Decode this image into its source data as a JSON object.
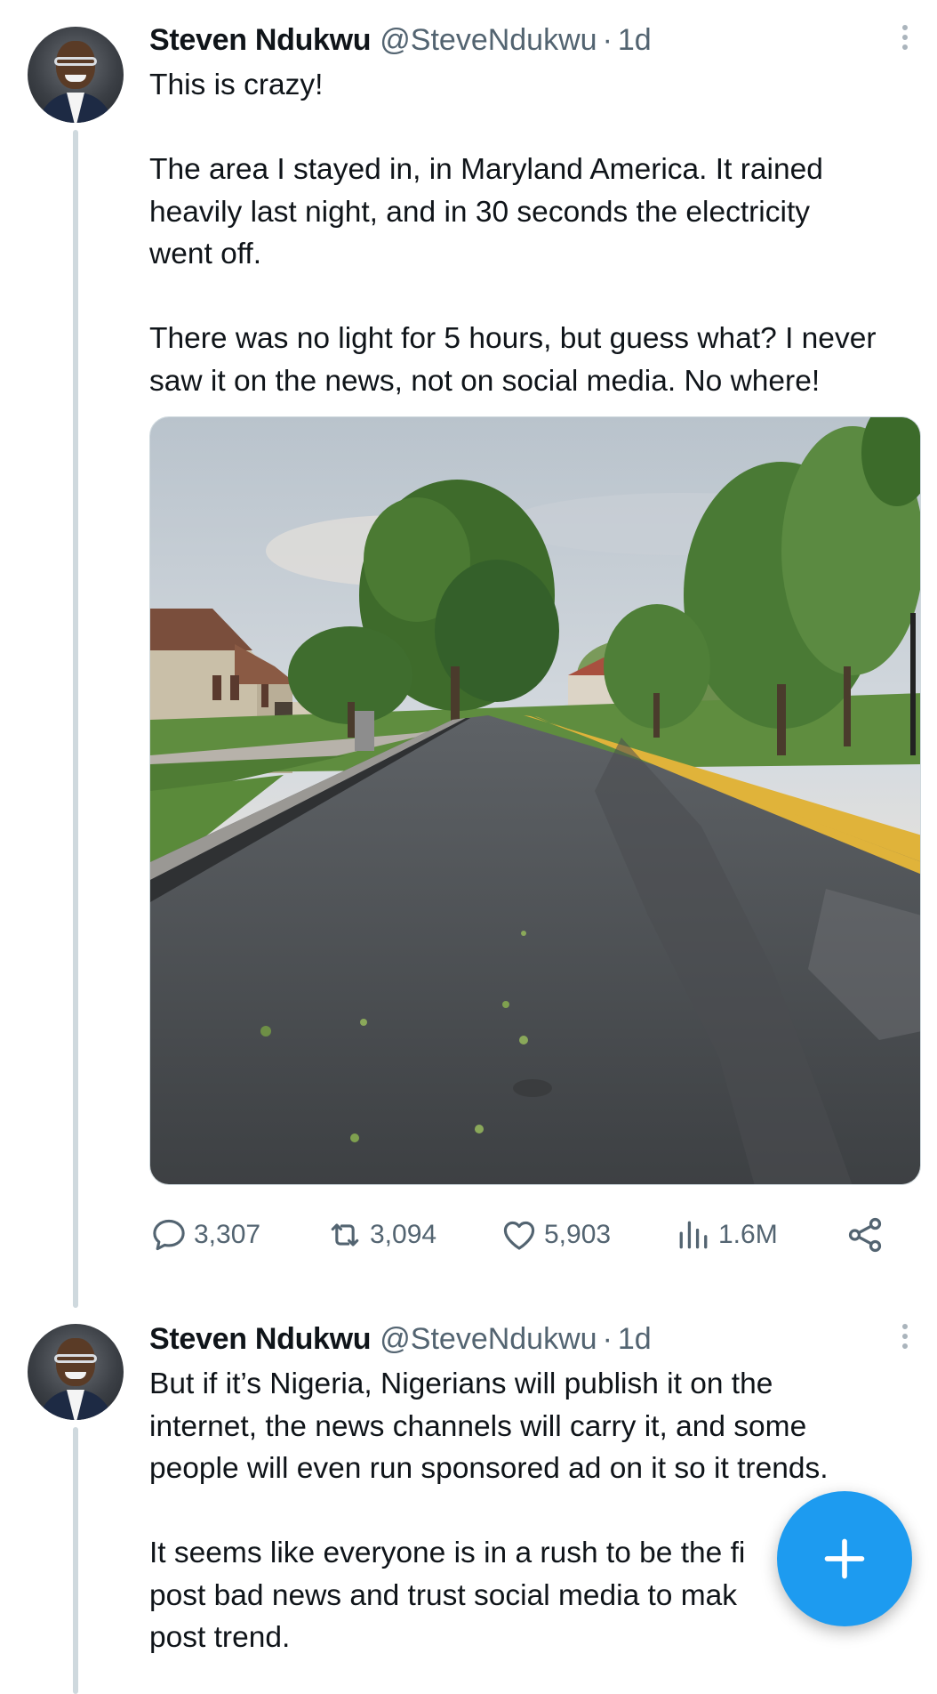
{
  "tweets": [
    {
      "author_name": "Steven Ndukwu",
      "handle": "@SteveNdukwu",
      "separator": "·",
      "time": "1d",
      "paragraphs": [
        [
          "This is crazy!"
        ],
        [
          "The area I stayed in, in Maryland America. It rained",
          "heavily last night, and in 30 seconds the electricity",
          "went off."
        ],
        [
          "There was no light for 5 hours, but guess what? I never",
          "saw it on the news, not on social media. No where!"
        ]
      ],
      "media": "photo of a wet suburban street lined with trees and houses after rain",
      "actions": {
        "replies": "3,307",
        "retweets": "3,094",
        "likes": "5,903",
        "views": "1.6M"
      }
    },
    {
      "author_name": "Steven Ndukwu",
      "handle": "@SteveNdukwu",
      "separator": "·",
      "time": "1d",
      "paragraphs": [
        [
          "But if it’s Nigeria, Nigerians will publish it on the",
          "internet, the news channels will carry it, and some",
          "people will even run sponsored ad on it so it trends."
        ],
        [
          "It seems like everyone is in a rush to be the fi",
          "post bad news and trust social media to mak",
          "post trend."
        ]
      ]
    }
  ],
  "icons": {
    "reply": "speech-bubble-icon",
    "retweet": "retweet-arrows-icon",
    "like": "heart-icon",
    "views": "bar-chart-icon",
    "share": "share-nodes-icon",
    "compose": "plus-icon",
    "more": "vertical-dots-icon"
  },
  "colors": {
    "accent": "#1d9bf0",
    "secondary_text": "#536471",
    "thread_line": "#cfd9de"
  }
}
